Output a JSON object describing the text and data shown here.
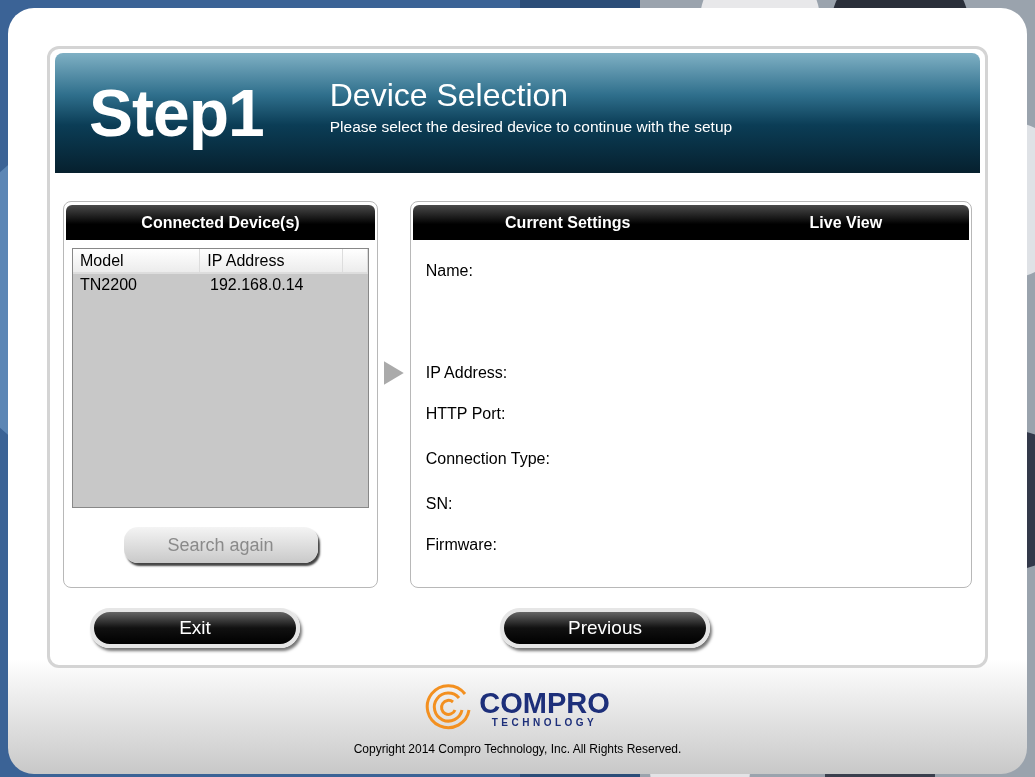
{
  "header": {
    "step": "Step1",
    "title": "Device Selection",
    "subtitle": "Please select the desired device to continue with the setup"
  },
  "devices_panel": {
    "title": "Connected Device(s)",
    "columns": [
      "Model",
      "IP Address"
    ],
    "rows": [
      {
        "cells": [
          "TN2200",
          "192.168.0.14"
        ]
      }
    ],
    "search_button": {
      "label": "Search again",
      "disabled": true
    }
  },
  "settings_panel": {
    "headings": [
      "Current Settings",
      "Live View"
    ],
    "fields": [
      {
        "label": "Name:"
      },
      {
        "label": "IP Address:"
      },
      {
        "label": "HTTP Port:"
      },
      {
        "label": "Connection Type:"
      },
      {
        "label": "SN:"
      },
      {
        "label": "Firmware:"
      }
    ]
  },
  "buttons": [
    {
      "label": "Exit"
    },
    {
      "label": "Previous"
    }
  ],
  "footer": {
    "logo_name": "COMPRO",
    "logo_sub": "TECHNOLOGY",
    "copyright": "Copyright 2014 Compro Technology, Inc. All Rights Reserved."
  }
}
